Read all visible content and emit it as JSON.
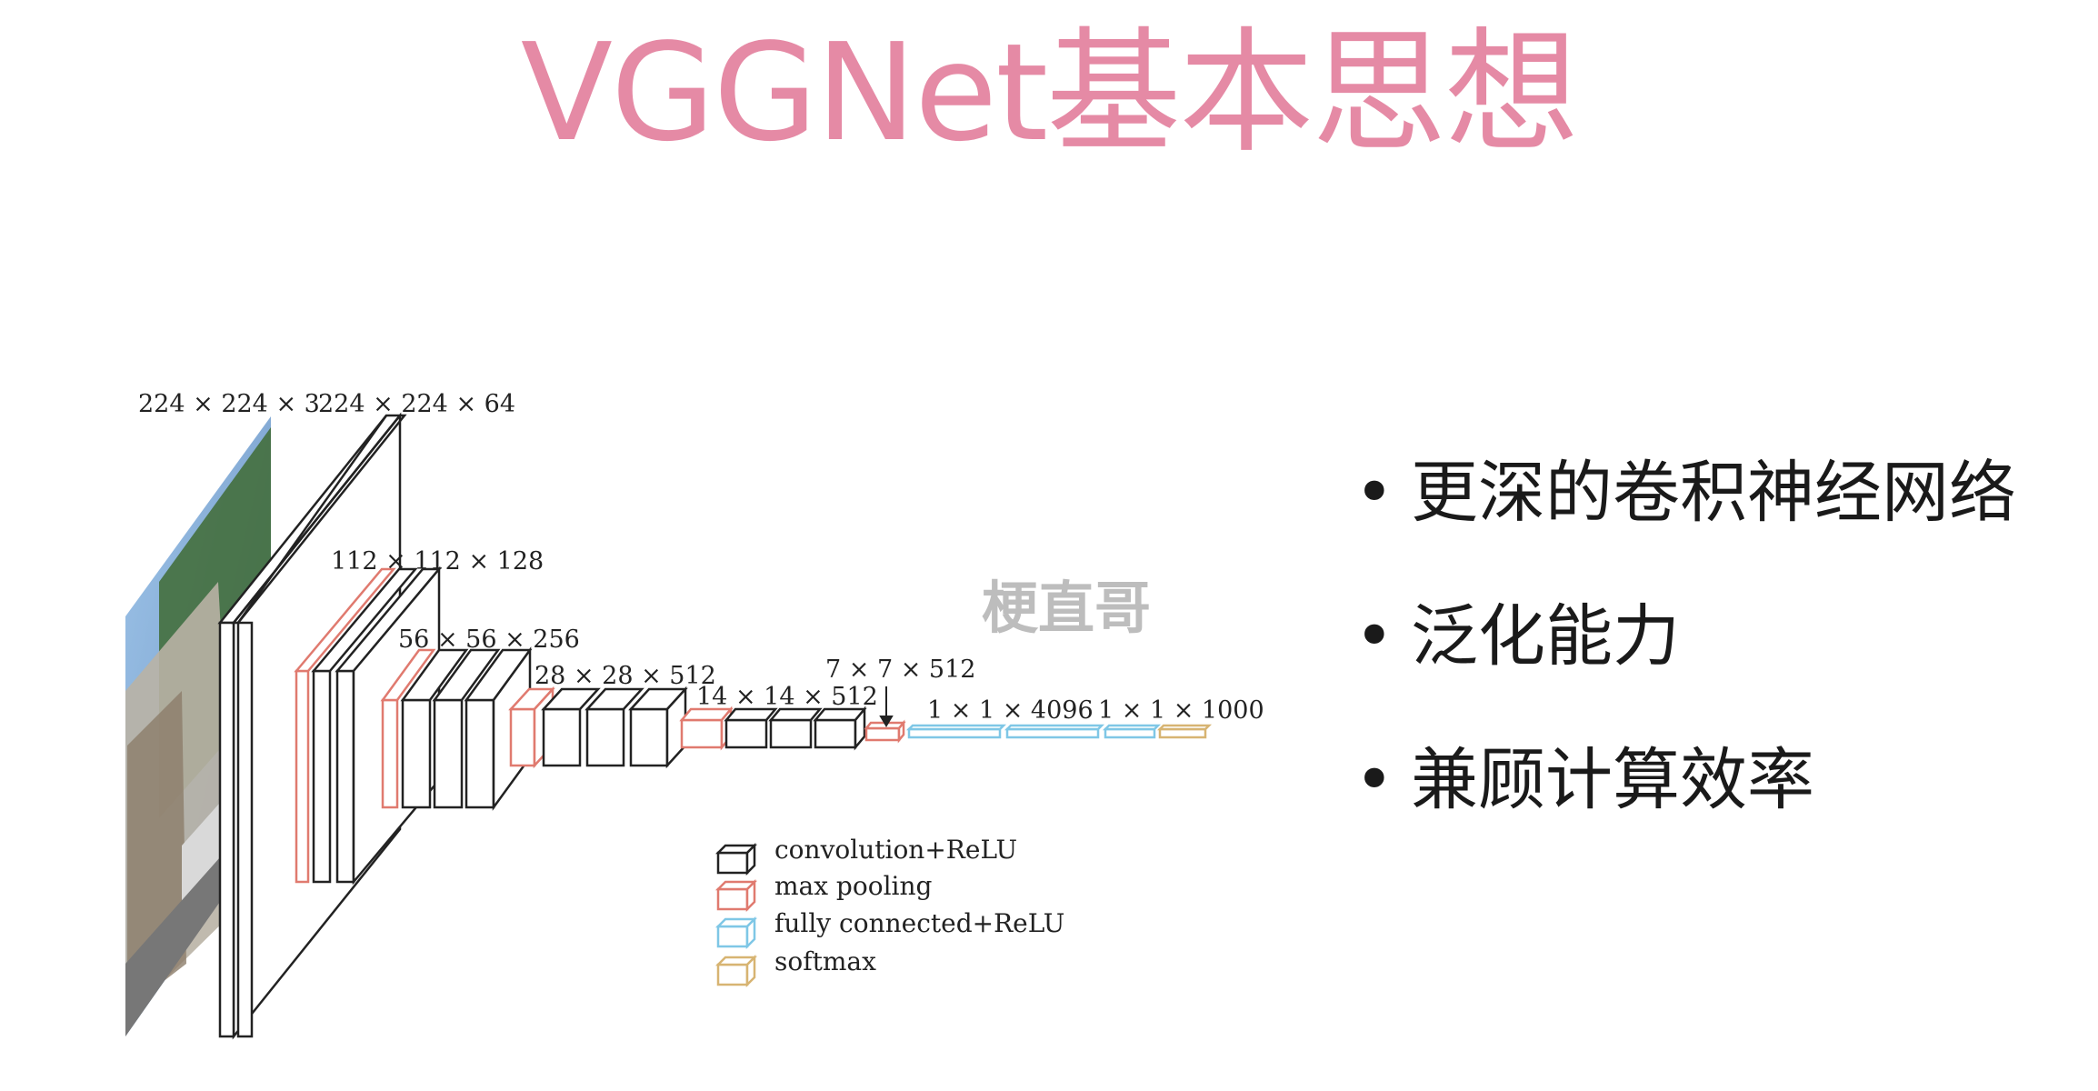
{
  "title": "VGGNet基本思想",
  "watermark": "梗直哥",
  "diagram": {
    "dims": {
      "input": "224 × 224 × 3",
      "conv1": "224 × 224 × 64",
      "conv2": "112 × 112 × 128",
      "conv3": "56 × 56 × 256",
      "conv4": "28 × 28 × 512",
      "conv5": "14 × 14 × 512",
      "pool5": "7 × 7 × 512",
      "fc": "1 × 1 × 4096",
      "softmax": "1 × 1 × 1000"
    },
    "legend": [
      {
        "label": "convolution+ReLU",
        "color": "#222222"
      },
      {
        "label": "max pooling",
        "color": "#e07a6f"
      },
      {
        "label": "fully connected+ReLU",
        "color": "#7fc7e6"
      },
      {
        "label": "softmax",
        "color": "#d7b472"
      }
    ]
  },
  "bullets": [
    {
      "marker": "•",
      "text": "更深的卷积神经网络"
    },
    {
      "marker": "•",
      "text": "泛化能力"
    },
    {
      "marker": "•",
      "text": "兼顾计算效率"
    }
  ]
}
